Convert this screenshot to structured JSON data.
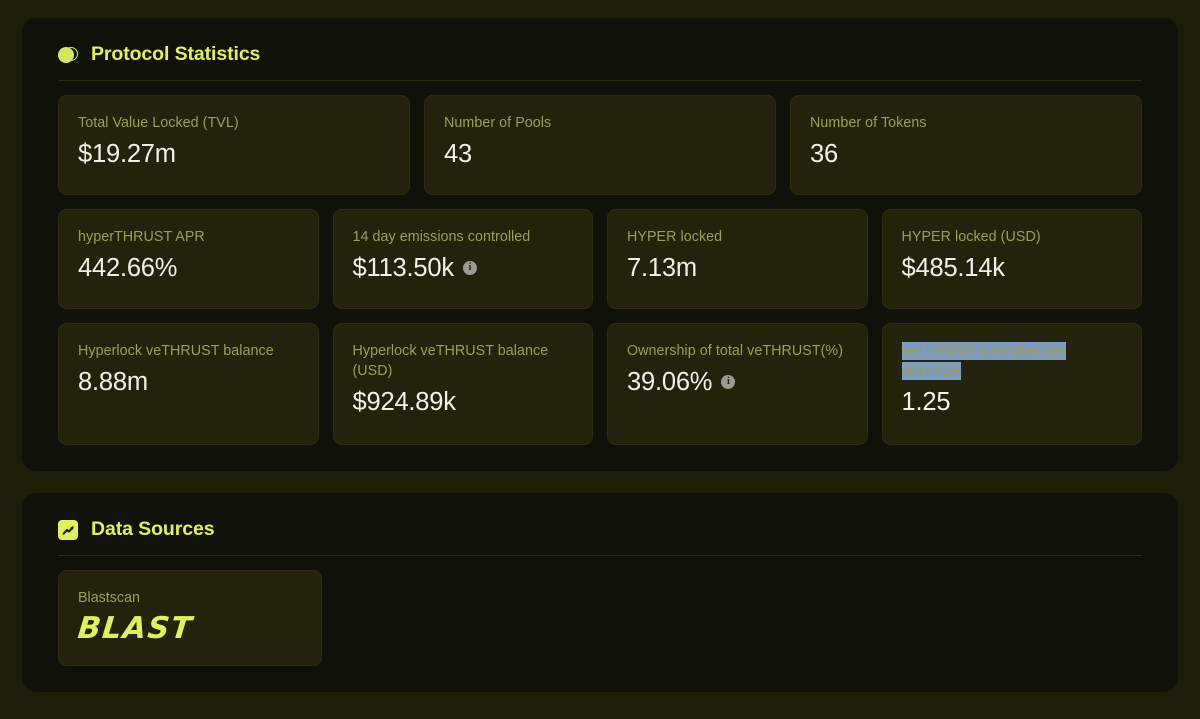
{
  "sections": [
    {
      "id": "protocol-statistics",
      "title": "Protocol Statistics",
      "icon": "contrast-icon",
      "rows": [
        [
          {
            "label": "Total Value Locked (TVL)",
            "value": "$19.27m",
            "info": false
          },
          {
            "label": "Number of Pools",
            "value": "43",
            "info": false
          },
          {
            "label": "Number of Tokens",
            "value": "36",
            "info": false
          }
        ],
        [
          {
            "label": "hyperTHRUST APR",
            "value": "442.66%",
            "info": false
          },
          {
            "label": "14 day emissions controlled",
            "value": "$113.50k",
            "info": true
          },
          {
            "label": "HYPER locked",
            "value": "7.13m",
            "info": false
          },
          {
            "label": "HYPER locked (USD)",
            "value": "$485.14k",
            "info": false
          }
        ],
        [
          {
            "label": "Hyperlock veTHRUST balance",
            "value": "8.88m",
            "info": false
          },
          {
            "label": "Hyperlock veTHRUST balance (USD)",
            "value": "$924.89k",
            "info": false
          },
          {
            "label": "Ownership of total veTHRUST(%)",
            "value": "39.06%",
            "info": true
          },
          {
            "label": "veTHRUST controlled per vlHYPER",
            "value": "1.25",
            "info": false,
            "selected": true
          }
        ]
      ]
    },
    {
      "id": "data-sources",
      "title": "Data Sources",
      "icon": "chart-trend-icon",
      "sources": [
        {
          "name": "Blastscan",
          "logo": "BLAST"
        }
      ]
    }
  ],
  "info_glyph": "i",
  "colors": {
    "accent": "#e0f257",
    "label": "#9ca04e",
    "value": "#f1f2e7",
    "page_bg": "#1c1e08",
    "panel_bg": "#10120a",
    "card_bg": "#23220a",
    "selection": "#7e9bc2"
  }
}
